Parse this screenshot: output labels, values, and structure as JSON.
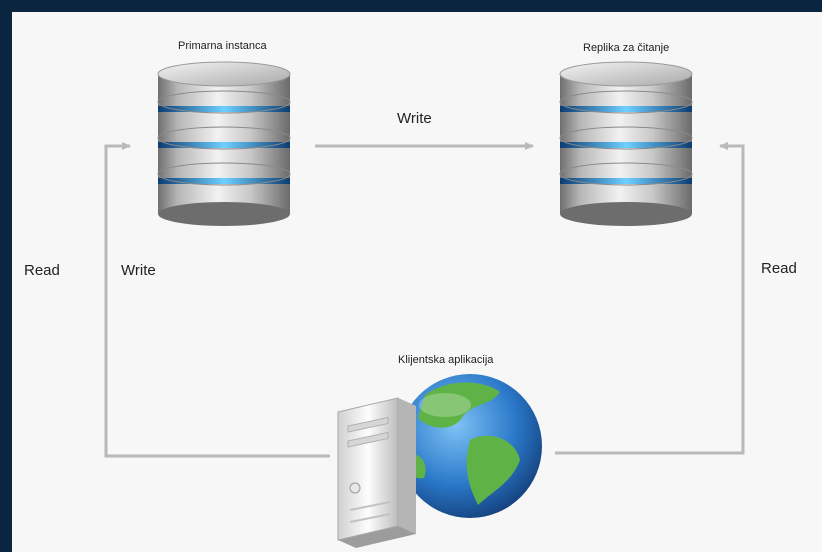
{
  "nodes": {
    "primary": {
      "label": "Primarna instanca"
    },
    "replica": {
      "label": "Replika za čitanje"
    },
    "client": {
      "label": "Klijentska aplikacija"
    }
  },
  "edges": {
    "primary_to_replica": {
      "label": "Write"
    },
    "client_to_primary_read": {
      "label": "Read"
    },
    "client_to_primary_write": {
      "label": "Write"
    },
    "client_to_replica_read": {
      "label": "Read"
    }
  },
  "colors": {
    "background_border": "#0a2540",
    "canvas": "#f7f7f7",
    "arrow": "#b9b9b9",
    "disk_glow": "#2f9de8",
    "globe_ocean": "#2a78c9",
    "globe_land": "#5fb346"
  },
  "icons": {
    "primary": "database-server-icon",
    "replica": "database-server-icon",
    "client": "client-computer-globe-icon"
  }
}
